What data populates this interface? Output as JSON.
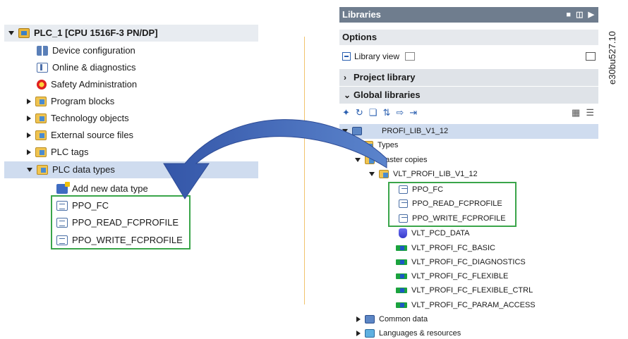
{
  "left_tree": {
    "root": "PLC_1 [CPU 1516F-3 PN/DP]",
    "items": [
      {
        "label": "Device configuration",
        "icon": "device-config-icon"
      },
      {
        "label": "Online & diagnostics",
        "icon": "diagnostics-icon"
      },
      {
        "label": "Safety Administration",
        "icon": "safety-icon"
      },
      {
        "label": "Program blocks",
        "icon": "folder-icon"
      },
      {
        "label": "Technology objects",
        "icon": "folder-icon"
      },
      {
        "label": "External source files",
        "icon": "folder-icon"
      },
      {
        "label": "PLC tags",
        "icon": "folder-icon"
      },
      {
        "label": "PLC data types",
        "icon": "folder-icon"
      },
      {
        "label": "Add new data type",
        "icon": "add-data-type-icon"
      },
      {
        "label": "PPO_FC",
        "icon": "data-type-icon"
      },
      {
        "label": "PPO_READ_FCPROFILE",
        "icon": "data-type-icon"
      },
      {
        "label": "PPO_WRITE_FCPROFILE",
        "icon": "data-type-icon"
      }
    ]
  },
  "libraries": {
    "title": "Libraries",
    "options": "Options",
    "library_view": "Library view",
    "project_library": "Project library",
    "global_libraries": "Global libraries",
    "tree": {
      "root": "PROFI_LIB_V1_12",
      "types": "Types",
      "master_copies": "Master copies",
      "master_folder": "VLT_PROFI_LIB_V1_12",
      "items": [
        {
          "label": "PPO_FC",
          "icon": "data-type-icon"
        },
        {
          "label": "PPO_READ_FCPROFILE",
          "icon": "data-type-icon"
        },
        {
          "label": "PPO_WRITE_FCPROFILE",
          "icon": "data-type-icon"
        },
        {
          "label": "VLT_PCD_DATA",
          "icon": "data-block-icon"
        },
        {
          "label": "VLT_PROFI_FC_BASIC",
          "icon": "function-block-icon"
        },
        {
          "label": "VLT_PROFI_FC_DIAGNOSTICS",
          "icon": "function-block-icon"
        },
        {
          "label": "VLT_PROFI_FC_FLEXIBLE",
          "icon": "function-block-icon"
        },
        {
          "label": "VLT_PROFI_FC_FLEXIBLE_CTRL",
          "icon": "function-block-icon"
        },
        {
          "label": "VLT_PROFI_FC_PARAM_ACCESS",
          "icon": "function-block-icon"
        }
      ],
      "common_data": "Common data",
      "languages": "Languages & resources"
    }
  },
  "watermark": "e30bu527.10",
  "colors": {
    "highlight": "#cfdcef",
    "green_box": "#3aa54a",
    "arrow": "#3f68b8",
    "title_bar": "#6f7d8e"
  }
}
